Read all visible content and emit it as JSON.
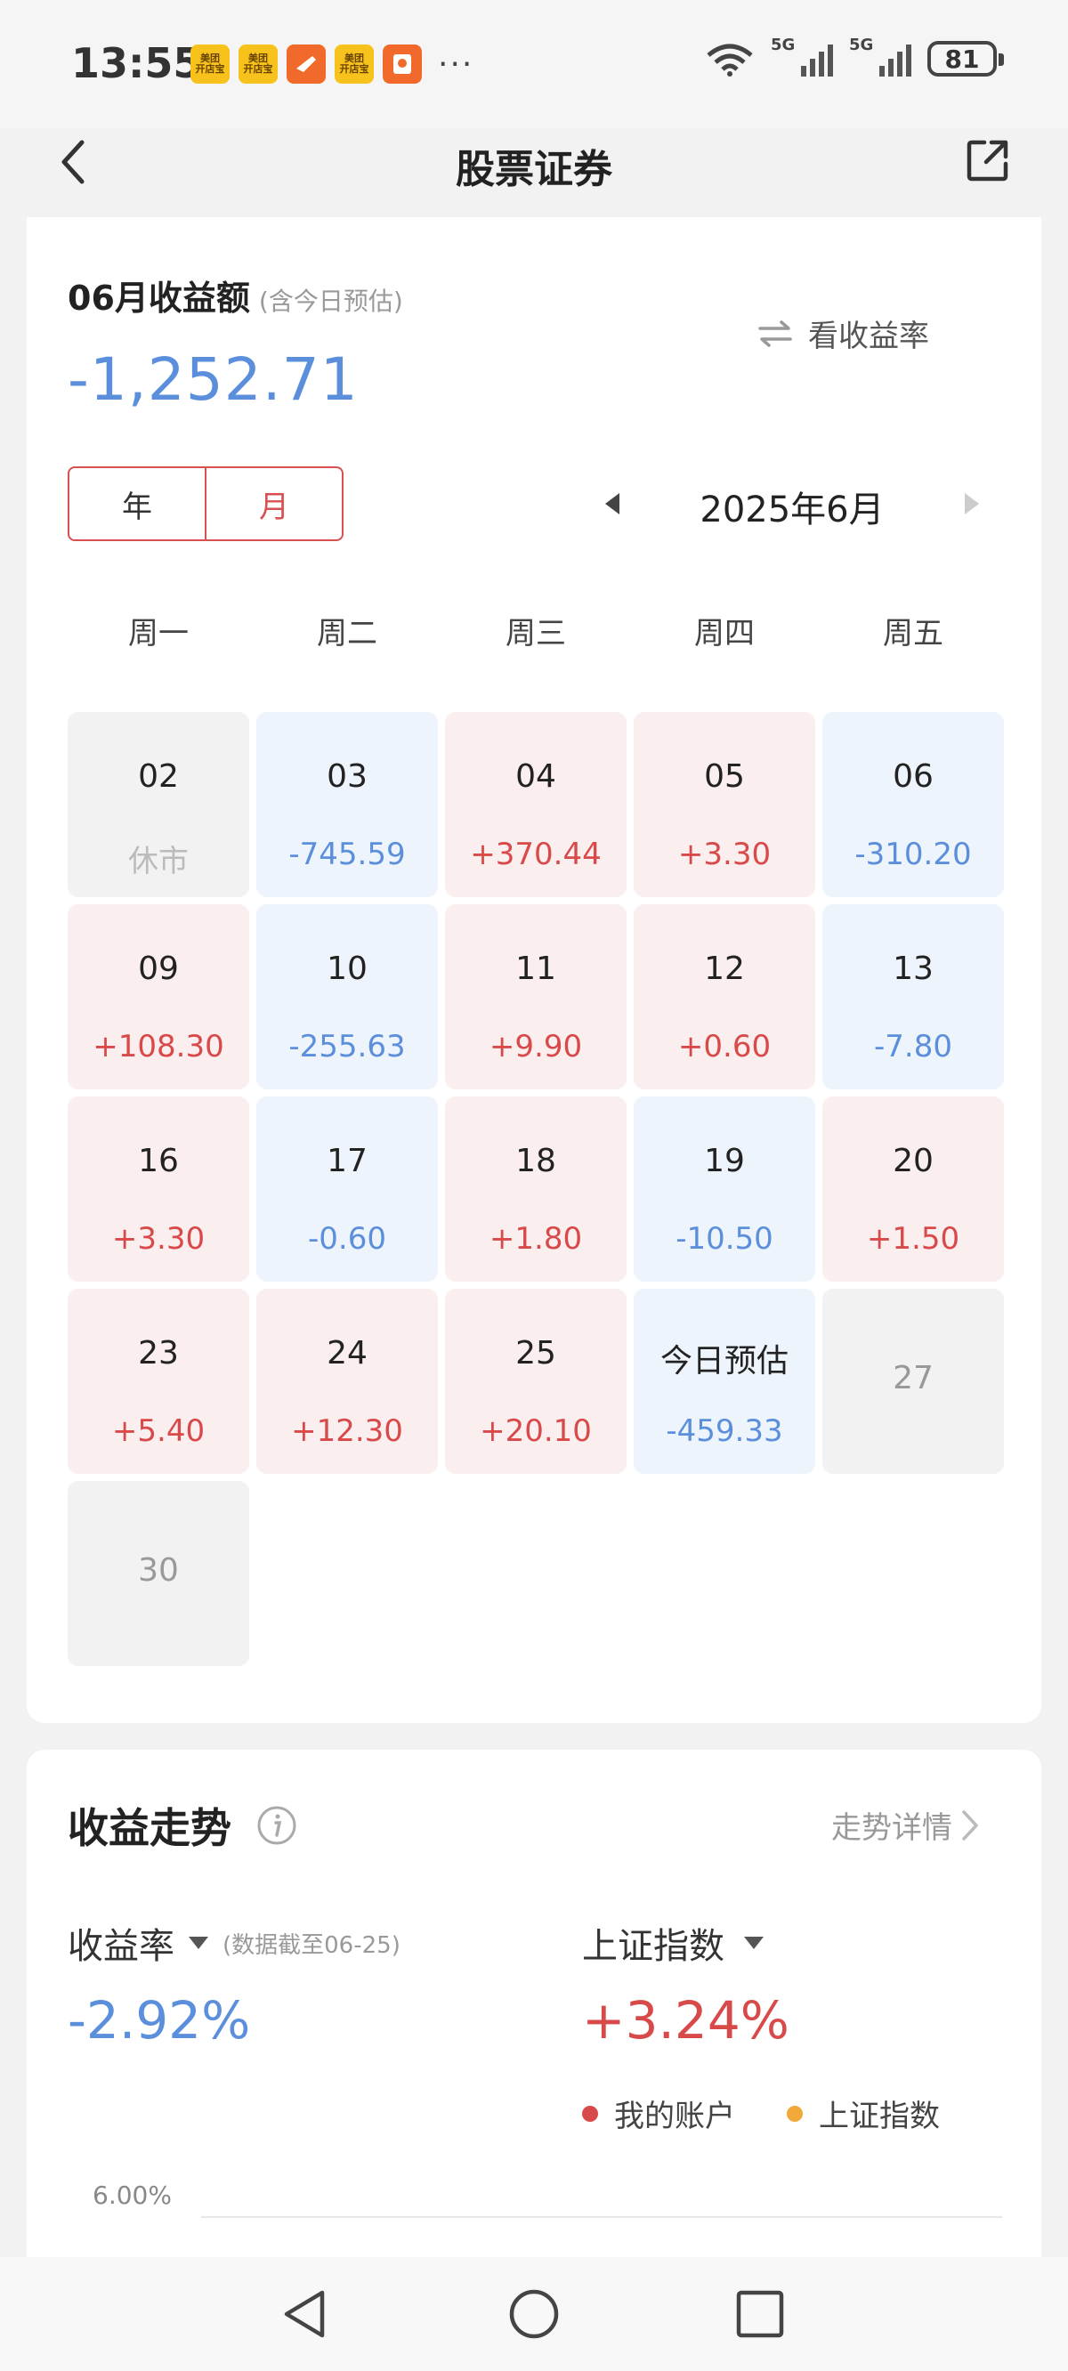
{
  "status_bar": {
    "time": "13:55",
    "app_icons": [
      {
        "name": "meituan-kaidianbao-icon",
        "label": "美团\n开店宝"
      },
      {
        "name": "meituan-kaidianbao-icon",
        "label": "美团\n开店宝"
      },
      {
        "name": "feishu-icon",
        "label": ""
      },
      {
        "name": "meituan-kaidianbao-icon",
        "label": "美团\n开店宝"
      },
      {
        "name": "red-envelope-icon",
        "label": ""
      }
    ],
    "more": "···",
    "signal_1": "5G",
    "signal_2": "5G",
    "battery": "81"
  },
  "header": {
    "title": "股票证券"
  },
  "summary": {
    "title": "06月收益额",
    "note": "(含今日预估)",
    "switch_label": "看收益率",
    "total": "-1,252.71",
    "total_color": "#5b8fdc"
  },
  "segment": {
    "year": "年",
    "month": "月",
    "active": "month"
  },
  "month_nav": {
    "label": "2025年6月"
  },
  "weekdays": [
    "周一",
    "周二",
    "周三",
    "周四",
    "周五"
  ],
  "calendar": [
    {
      "day": "02",
      "value": "休市",
      "type": "off"
    },
    {
      "day": "03",
      "value": "-745.59",
      "type": "down"
    },
    {
      "day": "04",
      "value": "+370.44",
      "type": "up"
    },
    {
      "day": "05",
      "value": "+3.30",
      "type": "up"
    },
    {
      "day": "06",
      "value": "-310.20",
      "type": "down"
    },
    {
      "day": "09",
      "value": "+108.30",
      "type": "up"
    },
    {
      "day": "10",
      "value": "-255.63",
      "type": "down"
    },
    {
      "day": "11",
      "value": "+9.90",
      "type": "up"
    },
    {
      "day": "12",
      "value": "+0.60",
      "type": "up"
    },
    {
      "day": "13",
      "value": "-7.80",
      "type": "down"
    },
    {
      "day": "16",
      "value": "+3.30",
      "type": "up"
    },
    {
      "day": "17",
      "value": "-0.60",
      "type": "down"
    },
    {
      "day": "18",
      "value": "+1.80",
      "type": "up"
    },
    {
      "day": "19",
      "value": "-10.50",
      "type": "down"
    },
    {
      "day": "20",
      "value": "+1.50",
      "type": "up"
    },
    {
      "day": "23",
      "value": "+5.40",
      "type": "up"
    },
    {
      "day": "24",
      "value": "+12.30",
      "type": "up"
    },
    {
      "day": "25",
      "value": "+20.10",
      "type": "up"
    },
    {
      "day": "今日预估",
      "value": "-459.33",
      "type": "down"
    },
    {
      "day": "27",
      "value": "",
      "type": "future"
    },
    {
      "day": "30",
      "value": "",
      "type": "future"
    }
  ],
  "trend": {
    "title": "收益走势",
    "detail_link": "走势详情",
    "left_metric": {
      "label": "收益率",
      "note": "(数据截至06-25)",
      "value": "-2.92%"
    },
    "right_metric": {
      "label": "上证指数",
      "value": "+3.24%"
    },
    "legend": [
      {
        "label": "我的账户",
        "color": "#d84a4a"
      },
      {
        "label": "上证指数",
        "color": "#f0a93a"
      }
    ],
    "y_tick": "6.00%"
  },
  "colors": {
    "up": "#d84a4a",
    "down": "#5b8fdc",
    "accent": "#d85050"
  }
}
